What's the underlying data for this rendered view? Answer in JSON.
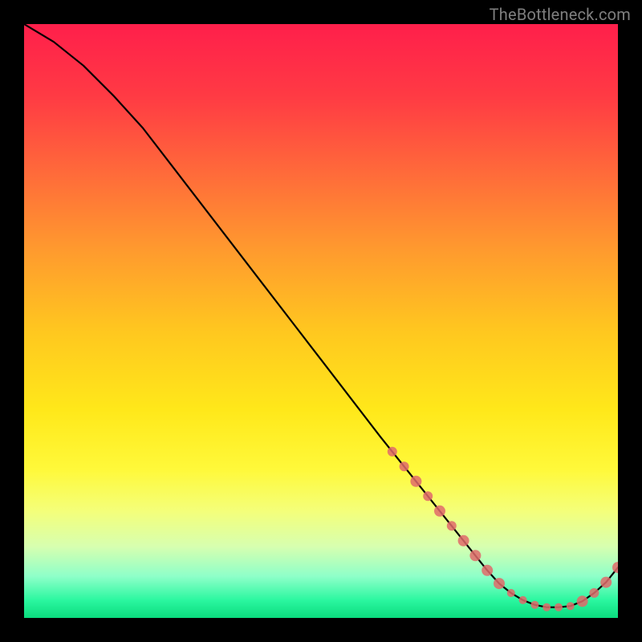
{
  "watermark": "TheBottleneck.com",
  "chart_data": {
    "type": "line",
    "title": "",
    "xlabel": "",
    "ylabel": "",
    "xlim": [
      0,
      100
    ],
    "ylim": [
      0,
      100
    ],
    "x": [
      0,
      5,
      10,
      15,
      20,
      25,
      30,
      35,
      40,
      45,
      50,
      55,
      60,
      62,
      64,
      66,
      68,
      70,
      72,
      74,
      76,
      78,
      80,
      82,
      84,
      86,
      88,
      90,
      92,
      94,
      96,
      98,
      100
    ],
    "values": [
      100,
      97,
      93,
      88,
      82.5,
      76,
      69.5,
      63,
      56.5,
      50,
      43.5,
      37,
      30.5,
      28,
      25.5,
      23,
      20.5,
      18,
      15.5,
      13,
      10.5,
      8,
      5.8,
      4.2,
      3.0,
      2.2,
      1.8,
      1.8,
      2.0,
      2.8,
      4.2,
      6.0,
      8.5
    ],
    "markers": {
      "x": [
        62,
        64,
        66,
        68,
        70,
        72,
        74,
        76,
        78,
        80,
        82,
        84,
        86,
        88,
        90,
        92,
        94,
        96,
        98,
        100
      ],
      "values": [
        28,
        25.5,
        23,
        20.5,
        18,
        15.5,
        13,
        10.5,
        8,
        5.8,
        4.2,
        3.0,
        2.2,
        1.8,
        1.8,
        2.0,
        2.8,
        4.2,
        6.0,
        8.5
      ],
      "size": [
        6,
        6,
        7,
        6,
        7,
        6,
        7,
        7,
        7,
        7,
        5,
        5,
        5,
        5,
        5,
        5,
        7,
        6,
        7,
        7
      ]
    },
    "colors": {
      "line": "#000000",
      "marker": "#e16a6a"
    }
  }
}
